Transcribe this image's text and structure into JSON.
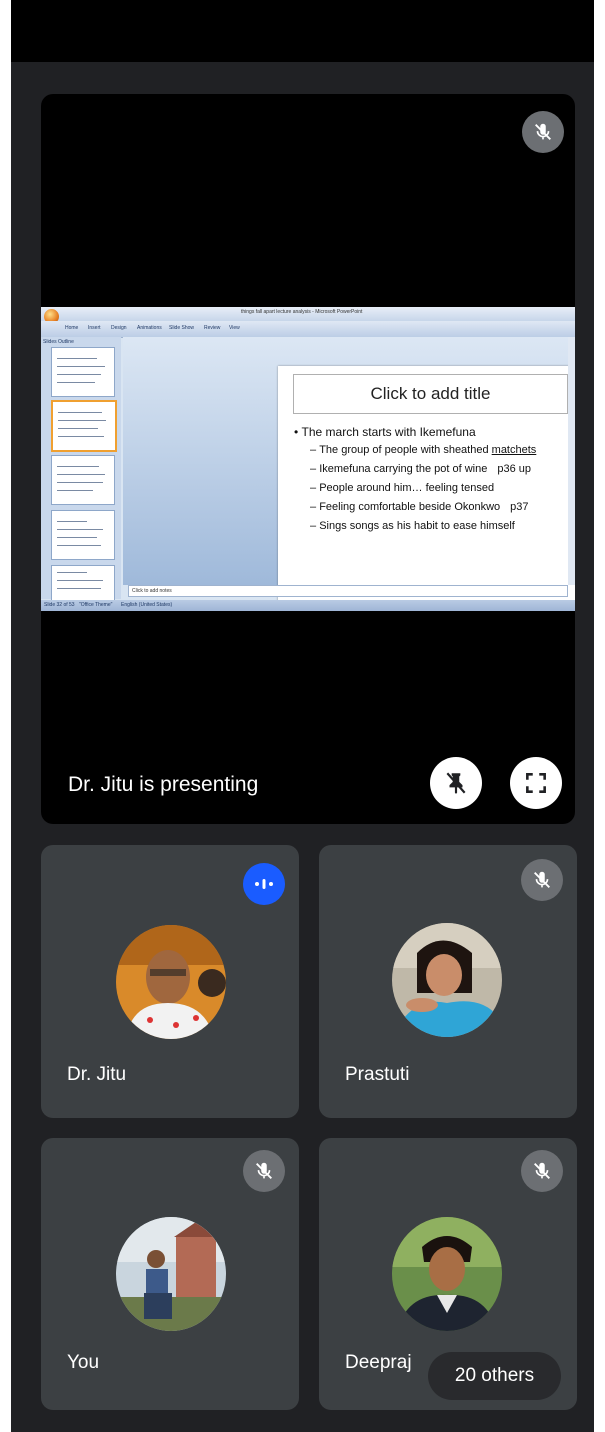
{
  "stage": {
    "presenting_label": "Dr. Jitu is presenting",
    "icons": {
      "muted": "mic-off-icon",
      "unpin": "unpin-icon",
      "fullscreen": "fullscreen-icon"
    },
    "shared_screen": {
      "window_title": "things fall apart lecture analysis - Microsoft PowerPoint",
      "ribbon_tabs": [
        "Home",
        "Insert",
        "Design",
        "Animations",
        "Slide Show",
        "Review",
        "View"
      ],
      "pane_tabs": [
        "Slides",
        "Outline"
      ],
      "slide": {
        "title_placeholder": "Click to add title",
        "bullet": "The march starts with Ikemefuna",
        "sub_bullets": [
          {
            "text": "The group of people with sheathed ",
            "underlined": "matchets",
            "page": ""
          },
          {
            "text": "Ikemefuna carrying the pot of wine",
            "underlined": "",
            "page": "p36 up"
          },
          {
            "text": "People around him… feeling tensed",
            "underlined": "",
            "page": ""
          },
          {
            "text": "Feeling comfortable beside Okonkwo",
            "underlined": "",
            "page": "p37"
          },
          {
            "text": "Sings songs as his habit to ease himself",
            "underlined": "",
            "page": ""
          }
        ]
      },
      "notes_placeholder": "Click to add notes",
      "status_left": "Slide 32 of 53",
      "status_theme": "\"Office Theme\"",
      "status_lang": "English (United States)"
    }
  },
  "participants": [
    {
      "name": "Dr. Jitu",
      "status_icon": "speaking-icon"
    },
    {
      "name": "Prastuti",
      "status_icon": "mic-off-icon"
    },
    {
      "name": "You",
      "status_icon": "mic-off-icon"
    },
    {
      "name": "Deepraj",
      "status_icon": "mic-off-icon"
    }
  ],
  "others_label": "20 others",
  "colors": {
    "background": "#202124",
    "tile": "#3c4043",
    "speaking": "#1a5cff"
  }
}
